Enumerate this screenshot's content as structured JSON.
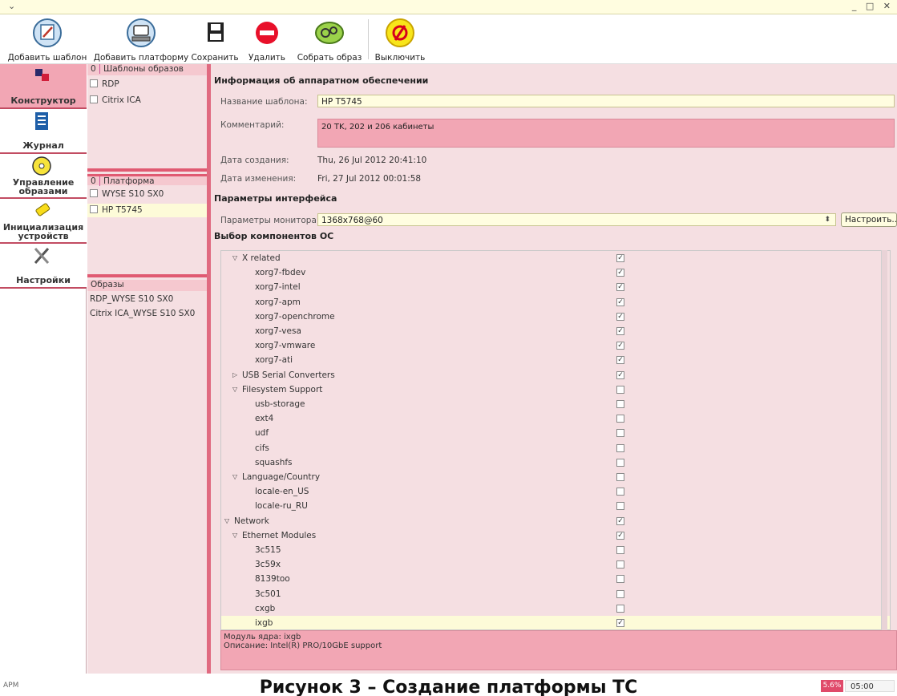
{
  "window": {
    "menu_glyph": "⌄",
    "controls": "_ □ ✕"
  },
  "toolbar": {
    "add_template": "Добавить шаблон",
    "add_platform": "Добавить платформу",
    "save": "Сохранить",
    "delete": "Удалить",
    "build_image": "Собрать образ",
    "shutdown": "Выключить"
  },
  "sidebar": {
    "items": [
      {
        "label": "Конструктор",
        "icon": "puzzle-icon",
        "active": true
      },
      {
        "label": "Журнал",
        "icon": "journal-icon"
      },
      {
        "label_l1": "Управление",
        "label_l2": "образами",
        "icon": "disc-icon"
      },
      {
        "label_l1": "Инициализация",
        "label_l2": "устройств",
        "icon": "usb-stick-icon"
      },
      {
        "label": "Настройки",
        "icon": "tools-icon"
      }
    ]
  },
  "middle": {
    "templates": {
      "count": "0",
      "title": "Шаблоны образов",
      "items": [
        "RDP",
        "Citrix ICA"
      ]
    },
    "platforms": {
      "count": "0",
      "title": "Платформа",
      "items": [
        "WYSE S10 SX0",
        "HP T5745"
      ]
    },
    "images": {
      "title": "Образы",
      "items": [
        "RDP_WYSE S10 SX0",
        "Citrix ICA_WYSE S10 SX0"
      ]
    }
  },
  "hardware": {
    "title": "Информация об аппаратном обеспечении",
    "name_label": "Название шаблона:",
    "name_value": "HP T5745",
    "comment_label": "Комментарий:",
    "comment_value": "20 TK, 202 и 206 кабинеты",
    "created_label": "Дата создания:",
    "created_value": "Thu, 26 Jul 2012 20:41:10",
    "modified_label": "Дата изменения:",
    "modified_value": "Fri, 27 Jul 2012 00:01:58"
  },
  "interface": {
    "title": "Параметры интерфейса",
    "monitor_label": "Параметры монитора:",
    "monitor_value": "1368x768@60",
    "configure_button": "Настроить..."
  },
  "components": {
    "title": "Выбор компонентов ОС",
    "rows": [
      {
        "label": "X related",
        "level": 1,
        "expander": "open",
        "checked": true
      },
      {
        "label": "xorg7-fbdev",
        "level": 2,
        "checked": true
      },
      {
        "label": "xorg7-intel",
        "level": 2,
        "checked": true
      },
      {
        "label": "xorg7-apm",
        "level": 2,
        "checked": true
      },
      {
        "label": "xorg7-openchrome",
        "level": 2,
        "checked": true
      },
      {
        "label": "xorg7-vesa",
        "level": 2,
        "checked": true
      },
      {
        "label": "xorg7-vmware",
        "level": 2,
        "checked": true
      },
      {
        "label": "xorg7-ati",
        "level": 2,
        "checked": true
      },
      {
        "label": "USB Serial Converters",
        "level": 1,
        "expander": "closed",
        "checked": true
      },
      {
        "label": "Filesystem Support",
        "level": 1,
        "expander": "open",
        "checked": false
      },
      {
        "label": "usb-storage",
        "level": 2,
        "checked": false
      },
      {
        "label": "ext4",
        "level": 2,
        "checked": false
      },
      {
        "label": "udf",
        "level": 2,
        "checked": false
      },
      {
        "label": "cifs",
        "level": 2,
        "checked": false
      },
      {
        "label": "squashfs",
        "level": 2,
        "checked": false
      },
      {
        "label": "Language/Country",
        "level": 1,
        "expander": "open",
        "checked": false
      },
      {
        "label": "locale-en_US",
        "level": 2,
        "checked": false
      },
      {
        "label": "locale-ru_RU",
        "level": 2,
        "checked": false
      },
      {
        "label": "Network",
        "level": 0,
        "expander": "open",
        "checked": true
      },
      {
        "label": "Ethernet Modules",
        "level": 1,
        "expander": "open",
        "checked": true
      },
      {
        "label": "3c515",
        "level": 2,
        "checked": false
      },
      {
        "label": "3c59x",
        "level": 2,
        "checked": false
      },
      {
        "label": "8139too",
        "level": 2,
        "checked": false
      },
      {
        "label": "3c501",
        "level": 2,
        "checked": false
      },
      {
        "label": "cxgb",
        "level": 2,
        "checked": false
      },
      {
        "label": "ixgb",
        "level": 2,
        "checked": true,
        "selected": true
      }
    ]
  },
  "description": {
    "module_line": "Модуль ядра: ixgb",
    "desc_line": "Описание: Intel(R) PRO/10GbE support"
  },
  "statusbar": {
    "apm": "APM",
    "caption": "Рисунок 3 – Создание платформы ТС",
    "cpu": "5.6%",
    "clock": "05:00"
  },
  "colors": {
    "accent": "#e05a72",
    "active_tab": "#f2a6b4",
    "panel_bg": "#f5dfe2",
    "input_bg": "#fffde0"
  }
}
